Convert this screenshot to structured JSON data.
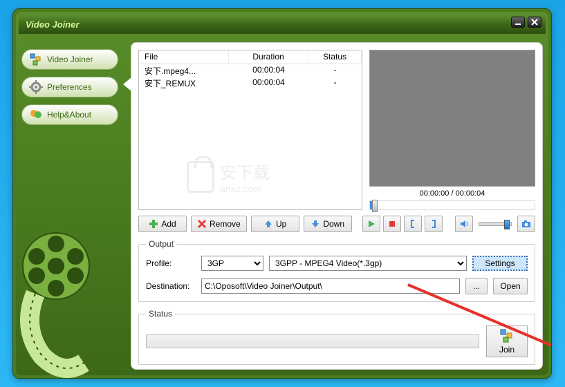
{
  "app": {
    "title": "Video Joiner"
  },
  "sidebar": {
    "items": [
      {
        "label": "Video Joiner",
        "icon": "joiner"
      },
      {
        "label": "Preferences",
        "icon": "gear"
      },
      {
        "label": "Help&About",
        "icon": "help"
      }
    ]
  },
  "fileList": {
    "headers": {
      "file": "File",
      "duration": "Duration",
      "status": "Status"
    },
    "rows": [
      {
        "file": "安下.mpeg4...",
        "duration": "00:00:04",
        "status": "-"
      },
      {
        "file": "安下_REMUX",
        "duration": "00:00:04",
        "status": "-"
      }
    ]
  },
  "preview": {
    "time": "00:00:00 / 00:00:04"
  },
  "actions": {
    "add": "Add",
    "remove": "Remove",
    "up": "Up",
    "down": "Down"
  },
  "output": {
    "legend": "Output",
    "profileLabel": "Profile:",
    "profileGroup": "3GP",
    "profileValue": "3GPP - MPEG4 Video(*.3gp)",
    "settings": "Settings",
    "destLabel": "Destination:",
    "destValue": "C:\\Oposoft\\Video Joiner\\Output\\",
    "browse": "...",
    "open": "Open"
  },
  "status": {
    "legend": "Status",
    "join": "Join"
  },
  "watermark": {
    "text1": "安下载",
    "text2": "anxz.com"
  }
}
